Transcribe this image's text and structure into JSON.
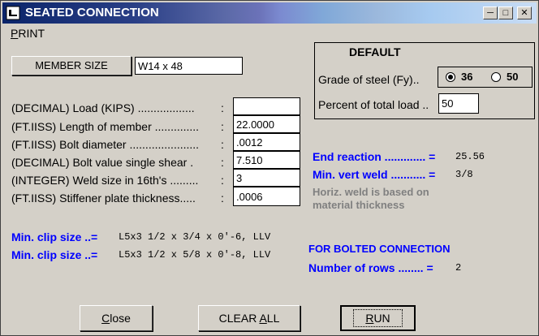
{
  "window": {
    "title": "SEATED CONNECTION"
  },
  "menu": {
    "print_first": "P",
    "print_rest": "RINT"
  },
  "member": {
    "button_label": "MEMBER SIZE",
    "value": "W14 x 48"
  },
  "inputs": [
    {
      "label": "(DECIMAL) Load (KIPS) ..................",
      "value": ""
    },
    {
      "label": "(FT.IISS) Length of member ..............",
      "value": "22.0000"
    },
    {
      "label": "(FT.IISS) Bolt diameter ......................",
      "value": ".0012"
    },
    {
      "label": "(DECIMAL) Bolt value single shear .",
      "value": "7.510"
    },
    {
      "label": "(INTEGER) Weld size in 16th's .........",
      "value": "3"
    },
    {
      "label": "(FT.IISS) Stiffener plate thickness.....",
      "value": ".0006"
    }
  ],
  "colon": ":",
  "default_box": {
    "title": "DEFAULT",
    "grade_label": "Grade of steel (Fy)..",
    "grade_options": [
      "36",
      "50"
    ],
    "grade_selected": "36",
    "percent_label": "Percent of total load ..",
    "percent_value": "50"
  },
  "results": {
    "end_reaction_label": "End reaction ............. =",
    "end_reaction_value": "25.56",
    "min_vert_weld_label": "Min. vert weld ........... =",
    "min_vert_weld_value": "3/8",
    "horiz_note_line1": "Horiz. weld is based on",
    "horiz_note_line2": "material thickness",
    "clip1_label": "Min. clip size ..=",
    "clip1_value": "L5x3 1/2 x 3/4 x 0'-6, LLV",
    "clip2_label": "Min. clip size ..=",
    "clip2_value": "L5x3 1/2 x 5/8 x 0'-8, LLV",
    "bolted_heading": "FOR BOLTED CONNECTION",
    "rows_label": "Number of rows ........ =",
    "rows_value": "2"
  },
  "buttons": {
    "close_first": "C",
    "close_rest": "lose",
    "clear_pre": "CLEAR ",
    "clear_u": "A",
    "clear_post": "LL",
    "run_pre": "",
    "run_u": "R",
    "run_post": "UN"
  },
  "icons": {
    "app": "app-icon",
    "minimize": "minimize-icon",
    "maximize": "maximize-icon",
    "close": "close-icon"
  }
}
